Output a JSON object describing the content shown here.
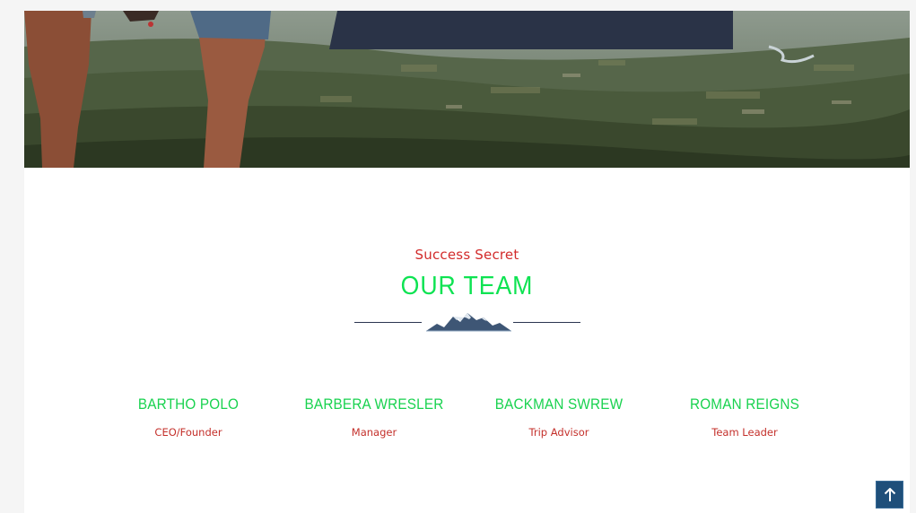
{
  "section": {
    "eyebrow": "Success Secret",
    "title": "OUR TEAM"
  },
  "team": [
    {
      "name": "BARTHO POLO",
      "role": "CEO/Founder"
    },
    {
      "name": "BARBERA WRESLER",
      "role": "Manager"
    },
    {
      "name": "BACKMAN SWREW",
      "role": "Trip Advisor"
    },
    {
      "name": "ROMAN REIGNS",
      "role": "Team Leader"
    }
  ],
  "colors": {
    "accent_green": "#0ee352",
    "accent_red": "#d22b2b",
    "navy": "#2b3550",
    "scroll_button": "#1f4f7a"
  },
  "icons": {
    "divider": "mountain-icon",
    "scroll_top": "arrow-up-icon"
  }
}
